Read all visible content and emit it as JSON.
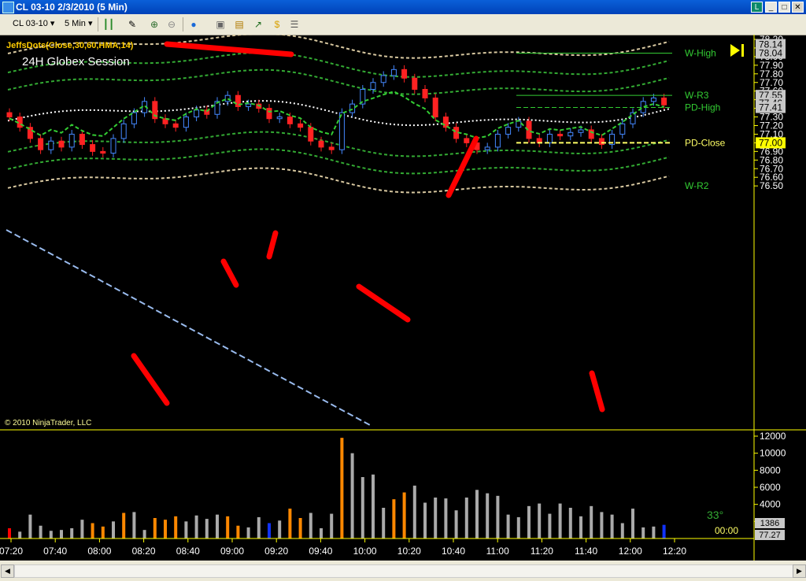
{
  "window": {
    "title": "CL 03-10  2/3/2010 (5 Min)"
  },
  "toolbar": {
    "instrument": "CL 03-10",
    "interval": "5 Min"
  },
  "chart": {
    "indicator_label": "JeffsDots(Close,30,60,HMA,14)",
    "session_label": "24H Globex Session",
    "copyright": "© 2010 NinjaTrader, LLC",
    "price_axis_ticks": [
      "78.20",
      "78.10",
      "78.00",
      "77.90",
      "77.80",
      "77.70",
      "77.60",
      "77.50",
      "77.40",
      "77.30",
      "77.20",
      "77.10",
      "77.00",
      "76.90",
      "76.80",
      "76.70",
      "76.60",
      "76.50"
    ],
    "price_markers": [
      {
        "label": "78.14",
        "price": 78.14,
        "color": "#c8c8c8"
      },
      {
        "label": "78.04",
        "price": 78.04,
        "color": "#c8c8c8"
      },
      {
        "label": "77.55",
        "price": 77.55,
        "color": "#c8c8c8"
      },
      {
        "label": "77.46",
        "price": 77.46,
        "color": "#c8c8c8"
      },
      {
        "label": "77.41",
        "price": 77.41,
        "color": "#c8c8c8"
      },
      {
        "label": "77.00",
        "price": 77.0,
        "color": "#ffff00"
      }
    ],
    "levels": [
      {
        "label": "W-High",
        "price": 78.04,
        "color": "#33cc33"
      },
      {
        "label": "W-R3",
        "price": 77.55,
        "color": "#33cc33"
      },
      {
        "label": "PD-High",
        "price": 77.41,
        "color": "#33cc33"
      },
      {
        "label": "PD-Close",
        "price": 77.0,
        "color": "#ffff66"
      },
      {
        "label": "W-R2",
        "price": 76.5,
        "color": "#33cc33"
      }
    ],
    "volume_axis_ticks": [
      "12000",
      "10000",
      "8000",
      "6000",
      "4000",
      "2000"
    ],
    "volume_markers": [
      "1386",
      "77.27"
    ],
    "countdown": {
      "degrees": "33°",
      "time": "00:00"
    },
    "time_ticks": [
      "07:20",
      "07:40",
      "08:00",
      "08:20",
      "08:40",
      "09:00",
      "09:20",
      "09:40",
      "10:00",
      "10:20",
      "10:40",
      "11:00",
      "11:20",
      "11:40",
      "12:00",
      "12:20"
    ]
  },
  "colors": {
    "up": "#4488ff",
    "down": "#ff2222",
    "mid_dots": "#ffffff",
    "green_band": "#33aa33",
    "tan_band": "#d8c8a0",
    "hma_up": "#33cc33",
    "hma_down": "#ff2222"
  }
}
